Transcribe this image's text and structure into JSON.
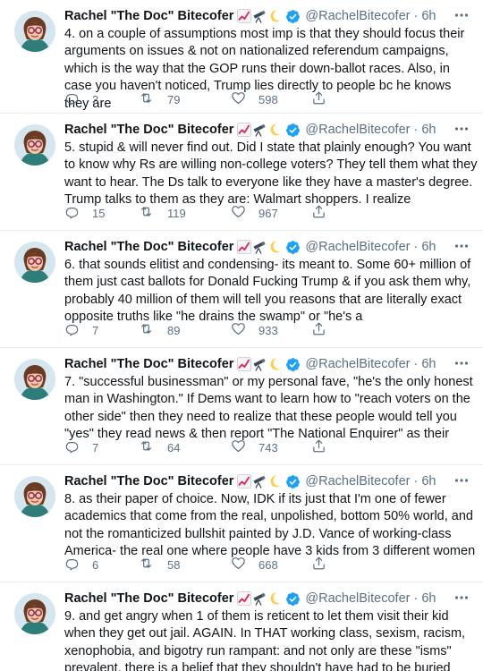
{
  "author": {
    "name": "Rachel \"The Doc\" Bitecofer",
    "handle": "@RachelBitecofer",
    "emoji_icons": [
      "chart-increasing-icon",
      "telescope-icon",
      "crescent-moon-icon"
    ],
    "verified": true
  },
  "colors": {
    "text": "#0f1419",
    "secondary": "#5b7083",
    "verified": "#1da1f2",
    "divider": "#e6ecf0"
  },
  "tweets": [
    {
      "time": "6h",
      "text": "4. on a couple of assumptions most imp is that they should focus their arguments on issues & not on nationalized referendum campaigns, which is the way that the GOP runs their down-ballot races. Also, in case you haven't noticed, Trump lies directly to people bc he knows they are",
      "replies": "3",
      "retweets": "79",
      "likes": "598"
    },
    {
      "time": "6h",
      "text": "5. stupid & will never find out. Did I state that plainly enough? You want to know why Rs are willing non-college voters? They tell them what they want to hear. The Ds talk to everyone like they have a master's degree. Trump talks to them as they are: Walmart shoppers. I realize",
      "replies": "15",
      "retweets": "119",
      "likes": "967"
    },
    {
      "time": "6h",
      "text": "6. that sounds elitist and condensing- its meant to. Some 60+ million of them just cast ballots for Donald Fucking Trump & if you ask them why, probably 40 million of them will tell you reasons that are literally exact opposite truths like \"he drains the swamp\" or \"he's a",
      "replies": "7",
      "retweets": "89",
      "likes": "933"
    },
    {
      "time": "6h",
      "text": "7. \"successful businessman\" or my personal fave, \"he's the only honest man in Washington.\" If Dems want to learn how to \"reach voters on the other side\" then they need to realize that these people would tell you \"yes\" they read news & then report \"The National Enquirer\" as their",
      "replies": "7",
      "retweets": "64",
      "likes": "743"
    },
    {
      "time": "6h",
      "text": "8. as their paper of choice. Now, IDK if its just that I'm one of fewer academics that come from the real, unpolished, bottom 50% world, and not the romanticized bullshit painted by J.D. Vance of working-class America- the real one where people have 3 kids from 3 different women",
      "replies": "6",
      "retweets": "58",
      "likes": "668"
    },
    {
      "time": "6h",
      "text": "9. and get angry when 1 of them is reticent to let them visit their kid when they get out jail. AGAIN. In THAT working class, sexism, racism, xenophobia, and bigotry run rampant: and not only are these \"isms\" prevalent, there is a belief that they shouldn't have had to be buried",
      "replies": "",
      "retweets": "",
      "likes": ""
    }
  ]
}
